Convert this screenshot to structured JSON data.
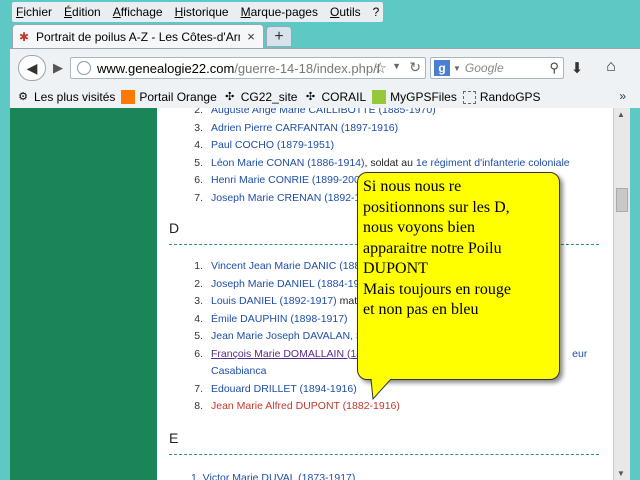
{
  "menu": [
    "Fichier",
    "Édition",
    "Affichage",
    "Historique",
    "Marque-pages",
    "Outils",
    "?"
  ],
  "tab": {
    "title": "Portrait de poilus A-Z - Les Côtes-d'Arm...",
    "close": "×",
    "new_tab": "+"
  },
  "nav": {
    "url_host": "www.genealogie22.com",
    "url_path": "/guerre-14-18/index.php/I",
    "search_placeholder": "Google",
    "search_engine_letter": "g",
    "icons": [
      "back-arrow-icon",
      "forward-arrow-icon",
      "globe-icon",
      "star-icon",
      "reload-icon",
      "google-icon",
      "magnifier-icon",
      "download-icon",
      "home-icon"
    ]
  },
  "bookmarks": [
    {
      "label": "Les plus visités",
      "icon": "gear-icon"
    },
    {
      "label": "Portail Orange",
      "icon": "orange-icon"
    },
    {
      "label": "CG22_site",
      "icon": "site-icon"
    },
    {
      "label": "CORAIL",
      "icon": "site-icon"
    },
    {
      "label": "MyGPSFiles",
      "icon": "mygps-icon"
    },
    {
      "label": "RandoGPS",
      "icon": "folder-icon"
    }
  ],
  "bookmarks_more": "»",
  "page": {
    "c_list": [
      {
        "n": "2.",
        "name": "Auguste Ange Marie CAILLIBOTTE (1885-1970)"
      },
      {
        "n": "3.",
        "name": "Adrien Pierre CARFANTAN (1897-1916)"
      },
      {
        "n": "4.",
        "name": "Paul COCHO (1879-1951)"
      },
      {
        "n": "5.",
        "name": "Léon Marie CONAN (1886-1914)",
        "mid": ", soldat au ",
        "tail": "1e régiment d'infanterie coloniale"
      },
      {
        "n": "6.",
        "name": "Henri Marie CONRIE (1899-2002)"
      },
      {
        "n": "7.",
        "name": "Joseph Marie CRENAN (1892-19"
      }
    ],
    "letter_d": "D",
    "d_list": [
      {
        "n": "1.",
        "name": "Vincent Jean Marie DANIC (188"
      },
      {
        "n": "2.",
        "name": "Joseph Marie DANIEL (1884-191"
      },
      {
        "n": "3.",
        "name": "Louis DANIEL (1892-1917)",
        "tail": " mate"
      },
      {
        "n": "4.",
        "name": "Émile DAUPHIN (1898-1917)"
      },
      {
        "n": "5.",
        "name": "Jean Marie Joseph DAVALAN, S"
      },
      {
        "n": "6.",
        "name": "François Marie DOMALLAIN (18",
        "tail": "eur",
        "line2": "Casabianca"
      },
      {
        "n": "7.",
        "name": "Edouard DRILLET (1894-1916)"
      },
      {
        "n": "8.",
        "name": "Jean Marie Alfred DUPONT (1882-1916)"
      }
    ],
    "letter_e": "E",
    "e_partial": "1.  Victor Marie DUVAL (1873-1917)"
  },
  "callout": {
    "lines": [
      "Si nous nous re",
      "positionnons sur les D,",
      "nous voyons bien",
      "apparaitre notre Poilu",
      "DUPONT",
      "Mais toujours en rouge",
      "et non pas en bleu"
    ]
  },
  "colors": {
    "sidebar": "#1a8658",
    "link": "#1e4ea8",
    "highlight_red": "#c0392b",
    "callout_bg": "#ffff00",
    "frame": "#5ec8c4"
  }
}
